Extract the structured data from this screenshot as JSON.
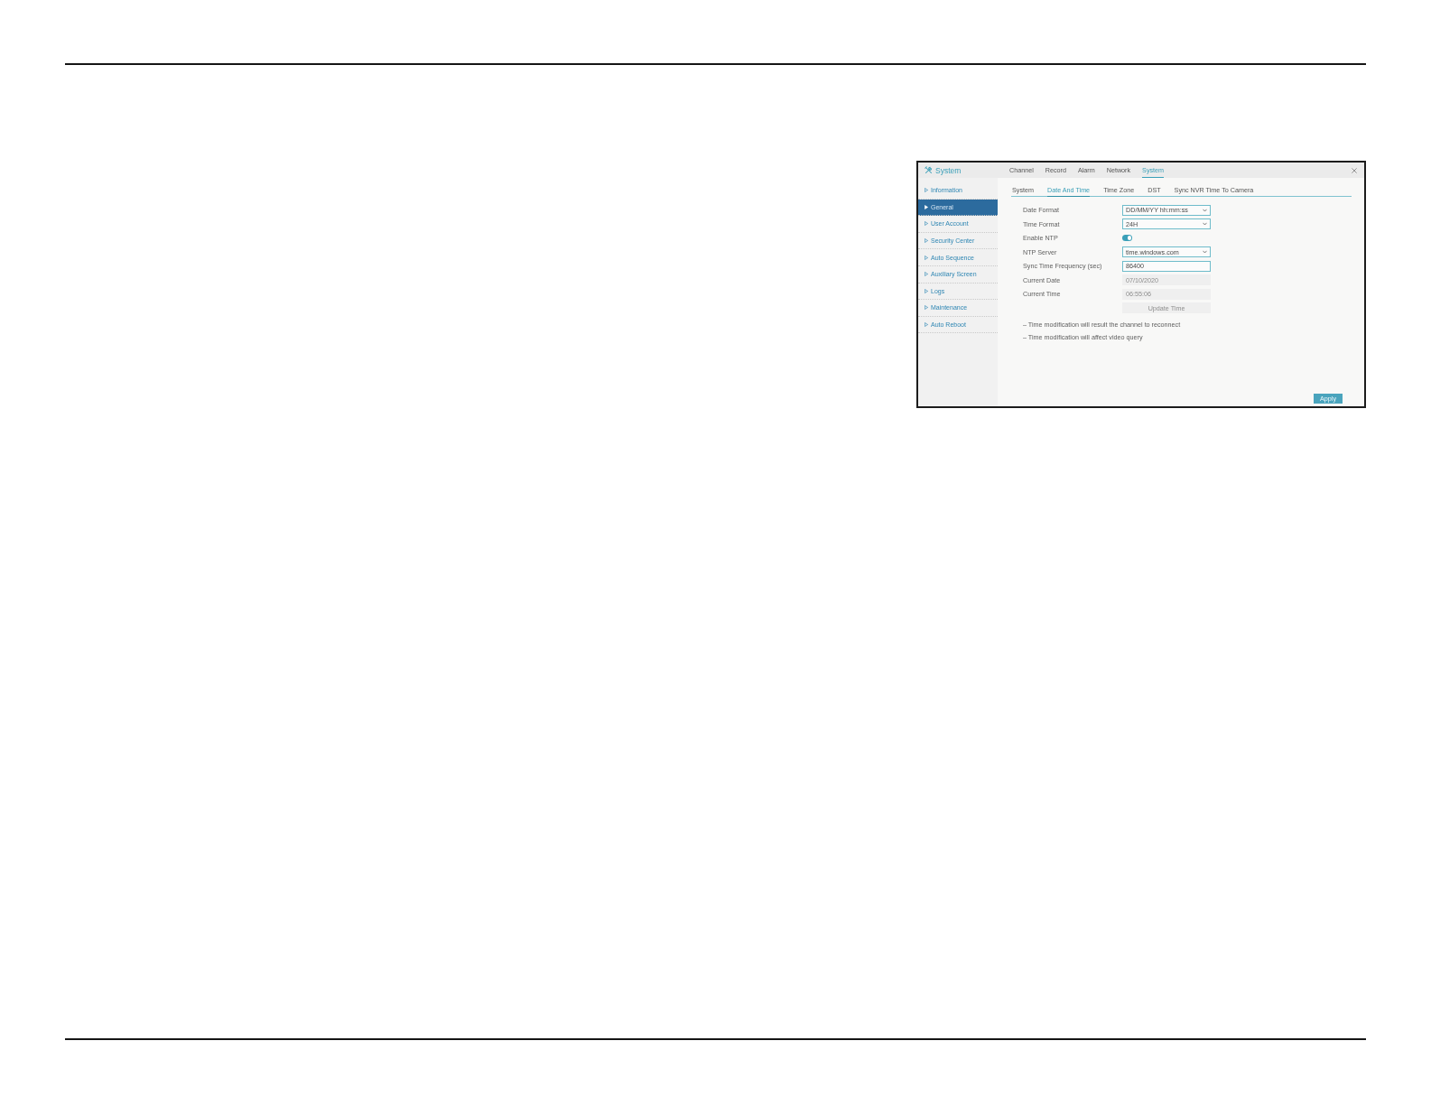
{
  "window": {
    "title": "System",
    "tabs": [
      {
        "label": "Channel",
        "selected": false
      },
      {
        "label": "Record",
        "selected": false
      },
      {
        "label": "Alarm",
        "selected": false
      },
      {
        "label": "Network",
        "selected": false
      },
      {
        "label": "System",
        "selected": true
      }
    ]
  },
  "sidebar": {
    "items": [
      {
        "label": "Information",
        "selected": false
      },
      {
        "label": "General",
        "selected": true
      },
      {
        "label": "User Account",
        "selected": false
      },
      {
        "label": "Security Center",
        "selected": false
      },
      {
        "label": "Auto Sequence",
        "selected": false
      },
      {
        "label": "Auxiliary Screen",
        "selected": false
      },
      {
        "label": "Logs",
        "selected": false
      },
      {
        "label": "Maintenance",
        "selected": false
      },
      {
        "label": "Auto Reboot",
        "selected": false
      }
    ]
  },
  "subtabs": [
    {
      "label": "System",
      "selected": false
    },
    {
      "label": "Date And Time",
      "selected": true
    },
    {
      "label": "Time Zone",
      "selected": false
    },
    {
      "label": "DST",
      "selected": false
    },
    {
      "label": "Sync NVR Time To Camera",
      "selected": false
    }
  ],
  "form": {
    "rows": [
      {
        "kind": "select",
        "label": "Date Format",
        "value": "DD/MM/YY hh:mm:ss"
      },
      {
        "kind": "select",
        "label": "Time Format",
        "value": "24H"
      },
      {
        "kind": "toggle",
        "label": "Enable NTP",
        "on": true
      },
      {
        "kind": "select",
        "label": "NTP Server",
        "value": "time.windows.com"
      },
      {
        "kind": "input",
        "label": "Sync Time Frequency (sec)",
        "value": "86400",
        "disabled": false
      },
      {
        "kind": "input",
        "label": "Current Date",
        "value": "07/10/2020",
        "disabled": true
      },
      {
        "kind": "input",
        "label": "Current Time",
        "value": "06:55:06",
        "disabled": true
      },
      {
        "kind": "button",
        "text": "Update Time",
        "disabled": true
      }
    ]
  },
  "notes": [
    "– Time modification will result the channel to reconnect",
    "– Time modification will affect video query"
  ],
  "apply_button": {
    "label": "Apply"
  }
}
